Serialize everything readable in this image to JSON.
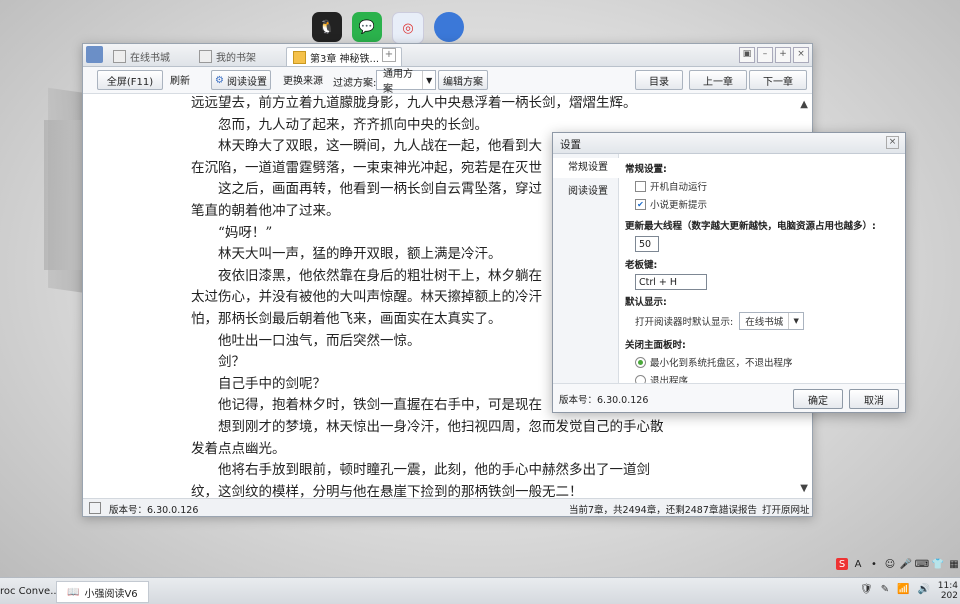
{
  "desktop": {
    "icons": [
      "qq-icon",
      "wechat-icon",
      "app-icon",
      "browser-icon"
    ]
  },
  "reader": {
    "tabs": [
      {
        "label": "在线书城"
      },
      {
        "label": "我的书架"
      },
      {
        "label": "第3章 神秘铁..."
      }
    ],
    "tab_add": "+",
    "toolbar": {
      "fullscreen": "全屏(F11)",
      "refresh": "刷新",
      "read_settings": "阅读设置",
      "change_source": "更换来源",
      "filter_label": "过滤方案:",
      "filter_value": "通用方案",
      "edit_scheme": "编辑方案",
      "catalog": "目录",
      "prev_chapter": "上一章",
      "next_chapter": "下一章"
    },
    "paragraphs": [
      "远远望去，前方立着九道朦胧身影，九人中央悬浮着一柄长剑，熠熠生辉。",
      "　　忽而，九人动了起来，齐齐抓向中央的长剑。",
      "　　林天睁大了双眼，这一瞬间，九人战在一起，他看到大",
      "在沉陷，一道道雷霆劈落，一束束神光冲起，宛若是在灭世",
      "　　这之后，画面再转，他看到一柄长剑自云霄坠落，穿过",
      "笔直的朝着他冲了过来。",
      "　　“妈呀！”",
      "　　林天大叫一声，猛的睁开双眼，额上满是冷汗。",
      "　　夜依旧漆黑，他依然靠在身后的粗壮树干上，林夕躺在",
      "太过伤心，并没有被他的大叫声惊醒。林天擦掉额上的冷汗",
      "怕，那柄长剑最后朝着他飞来，画面实在太真实了。",
      "　　他吐出一口浊气，而后突然一惊。",
      "　　剑？",
      "　　自己手中的剑呢？",
      "　　他记得，抱着林夕时，铁剑一直握在右手中，可是现在",
      "　　想到刚才的梦境，林天惊出一身冷汗，他扫视四周，忽而发觉自己的手心散",
      "发着点点幽光。",
      "　　他将右手放到眼前，顿时瞳孔一震，此刻，他的手心中赫然多出了一道剑",
      "纹，这剑纹的模样，分明与他在悬崖下捡到的那柄铁剑一般无二！"
    ],
    "status": {
      "version": "版本号：6.30.0.126",
      "progress": "当前7章，共2494章，还剩2487章。",
      "error_report": "错误报告",
      "open_url": "打开原网址"
    }
  },
  "settings": {
    "title": "设置",
    "nav": [
      "常规设置",
      "阅读设置"
    ],
    "general_heading": "常规设置:",
    "autostart": "开机自动运行",
    "novel_update": "小说更新提示",
    "max_threads_label": "更新最大线程（数字越大更新越快，电脑资源占用也越多）:",
    "max_threads_value": "50",
    "boss_key_label": "老板键:",
    "boss_key_value": "Ctrl + H",
    "default_display_label": "默认显示:",
    "open_reader_label": "打开阅读器时默认显示:",
    "open_reader_value": "在线书城",
    "close_panel_label": "关闭主面板时:",
    "minimize_option": "最小化到系统托盘区，不退出程序",
    "exit_option": "退出程序",
    "version": "版本号：6.30.0.126",
    "ok": "确定",
    "cancel": "取消"
  },
  "taskbar": {
    "task1": "roc Conve...",
    "task2": "小强阅读V6",
    "clock_time": "11:4",
    "clock_date": "202"
  }
}
